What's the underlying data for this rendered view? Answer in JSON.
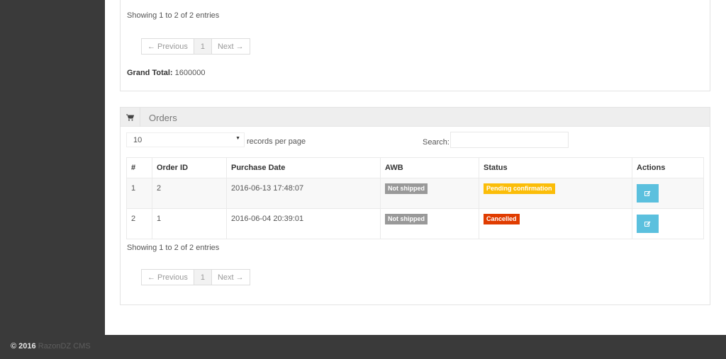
{
  "top_panel": {
    "info": "Showing 1 to 2 of 2 entries",
    "pager": {
      "prev": "← Previous",
      "page": "1",
      "next": "Next →"
    },
    "grand_total_label": "Grand Total:",
    "grand_total_value": "1600000"
  },
  "orders_panel": {
    "icon": "cart-icon",
    "title": "Orders",
    "length_select_value": "10",
    "records_per_page": "records per page",
    "search_label": "Search:",
    "search_value": "",
    "columns": [
      "#",
      "Order ID",
      "Purchase Date",
      "AWB",
      "Status",
      "Actions"
    ],
    "rows": [
      {
        "num": "1",
        "order_id": "2",
        "date": "2016-06-13 17:48:07",
        "awb": "Not shipped",
        "status": "Pending confirmation",
        "status_color": "#fbbd08",
        "action_icon": "edit-icon"
      },
      {
        "num": "2",
        "order_id": "1",
        "date": "2016-06-04 20:39:01",
        "awb": "Not shipped",
        "status": "Cancelled",
        "status_color": "#e03c00",
        "action_icon": "edit-icon"
      }
    ],
    "info": "Showing 1 to 2 of 2 entries",
    "pager": {
      "prev": "← Previous",
      "page": "1",
      "next": "Next →"
    }
  },
  "footer": {
    "copyright": "© 2016",
    "brand": "RazonDZ CMS"
  },
  "colors": {
    "sidebar": "#3a3a3a",
    "action_button": "#5bc0de",
    "awb_badge": "#999999"
  }
}
